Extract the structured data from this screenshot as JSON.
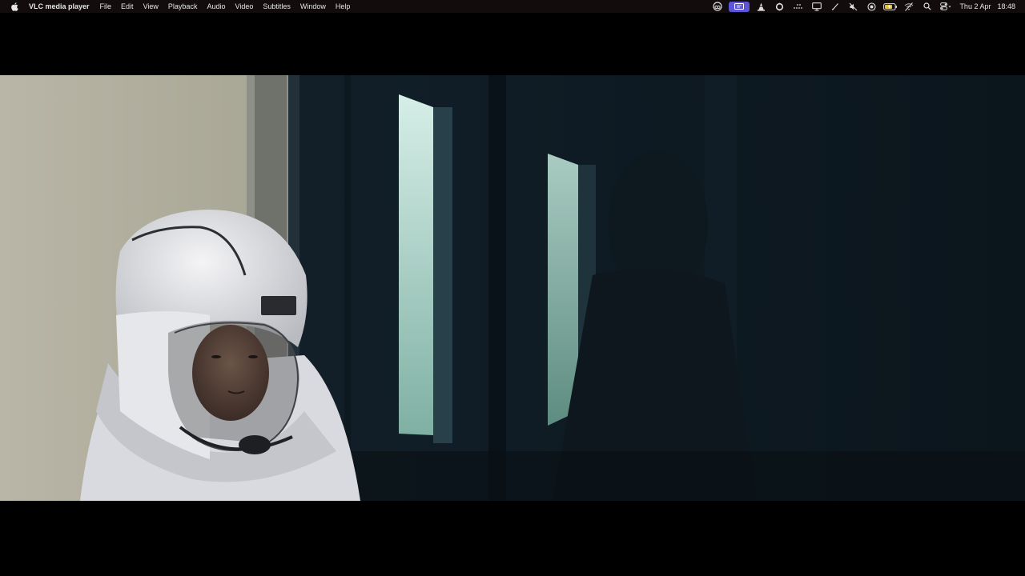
{
  "app": {
    "name": "VLC media player"
  },
  "menu": {
    "items": [
      "File",
      "Edit",
      "View",
      "Playback",
      "Audio",
      "Video",
      "Subtitles",
      "Window",
      "Help"
    ]
  },
  "status_bar": {
    "icons": [
      "creative-cloud-icon",
      "screen-mirroring-icon",
      "vlc-cone-icon",
      "sync-icon",
      "dots-icon",
      "display-icon",
      "pen-icon",
      "muted-speaker-icon",
      "record-icon",
      "battery-icon",
      "wifi-off-icon",
      "search-icon",
      "control-center-icon"
    ],
    "date": "Thu 2 Apr",
    "time": "18:48"
  },
  "colors": {
    "menubar_bg": "#120c0c",
    "active_status_bg": "#5d55d6",
    "letterbox": "#000000"
  }
}
